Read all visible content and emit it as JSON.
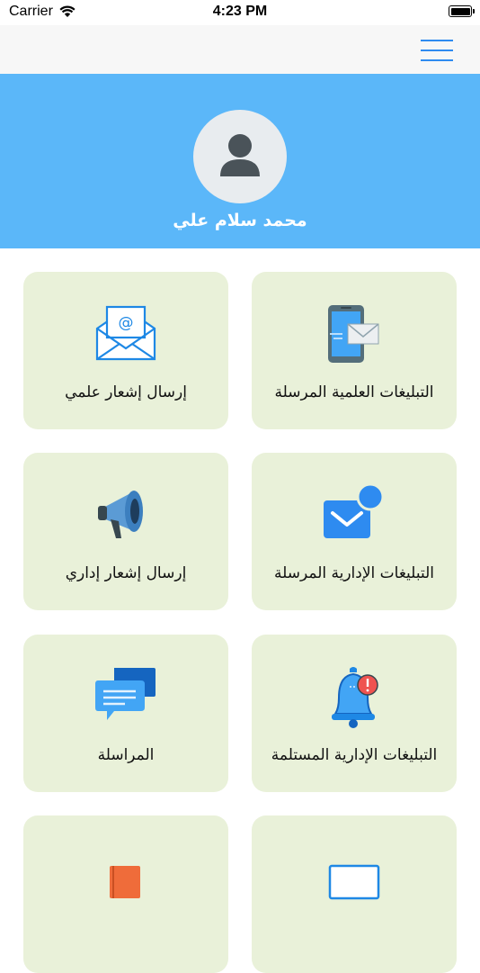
{
  "status_bar": {
    "carrier": "Carrier",
    "time": "4:23 PM"
  },
  "profile": {
    "name": "محمد سلام علي"
  },
  "cards": [
    {
      "label": "التبليغات العلمية المرسلة",
      "icon": "phone-envelope-icon"
    },
    {
      "label": "إرسال إشعار علمي",
      "icon": "email-envelope-icon"
    },
    {
      "label": "التبليغات الإدارية المرسلة",
      "icon": "mail-notification-icon"
    },
    {
      "label": "إرسال إشعار إداري",
      "icon": "megaphone-icon"
    },
    {
      "label": "التبليغات الإدارية المستلمة",
      "icon": "bell-alert-icon"
    },
    {
      "label": "المراسلة",
      "icon": "chat-bubbles-icon"
    }
  ],
  "colors": {
    "header": "#5bb7f9",
    "card": "#e9f1d9",
    "accent": "#2e8bf0"
  }
}
